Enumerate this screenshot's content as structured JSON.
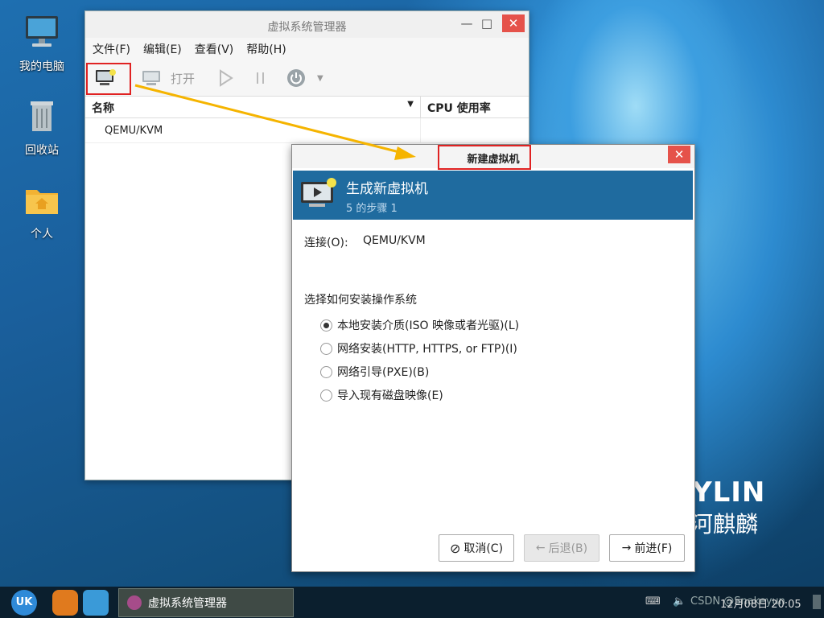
{
  "desktop": {
    "icons": [
      {
        "label": "我的电脑",
        "icon": "computer-icon"
      },
      {
        "label": "回收站",
        "icon": "trash-icon"
      },
      {
        "label": "个人",
        "icon": "home-folder-icon"
      }
    ],
    "brand_latin": "YLIN",
    "brand_cn": "河麒麟"
  },
  "main_window": {
    "title": "虚拟系统管理器",
    "menu": [
      "文件(F)",
      "编辑(E)",
      "查看(V)",
      "帮助(H)"
    ],
    "toolbar": {
      "open_label": "打开"
    },
    "columns": {
      "name": "名称",
      "cpu": "CPU 使用率"
    },
    "rows": [
      {
        "name": "QEMU/KVM",
        "cpu": ""
      }
    ]
  },
  "dialog": {
    "title": "新建虚拟机",
    "header": "生成新虚拟机",
    "step": "5 的步骤 1",
    "connection_label": "连接(O):",
    "connection_value": "QEMU/KVM",
    "install_prompt": "选择如何安装操作系统",
    "options": [
      {
        "label": "本地安装介质(ISO 映像或者光驱)(L)",
        "selected": true
      },
      {
        "label": "网络安装(HTTP, HTTPS, or FTP)(I)",
        "selected": false
      },
      {
        "label": "网络引导(PXE)(B)",
        "selected": false
      },
      {
        "label": "导入现有磁盘映像(E)",
        "selected": false
      }
    ],
    "buttons": {
      "cancel": "取消(C)",
      "back": "后退(B)",
      "forward": "前进(F)"
    }
  },
  "taskbar": {
    "task_label": "虚拟系统管理器",
    "clock": "12月08日 20:05",
    "watermark": "CSDN @Snakeyun"
  },
  "colors": {
    "accent": "#1f6b9f",
    "highlight_box": "#e02222",
    "arrow": "#f5b400",
    "close_button": "#e5524a"
  }
}
